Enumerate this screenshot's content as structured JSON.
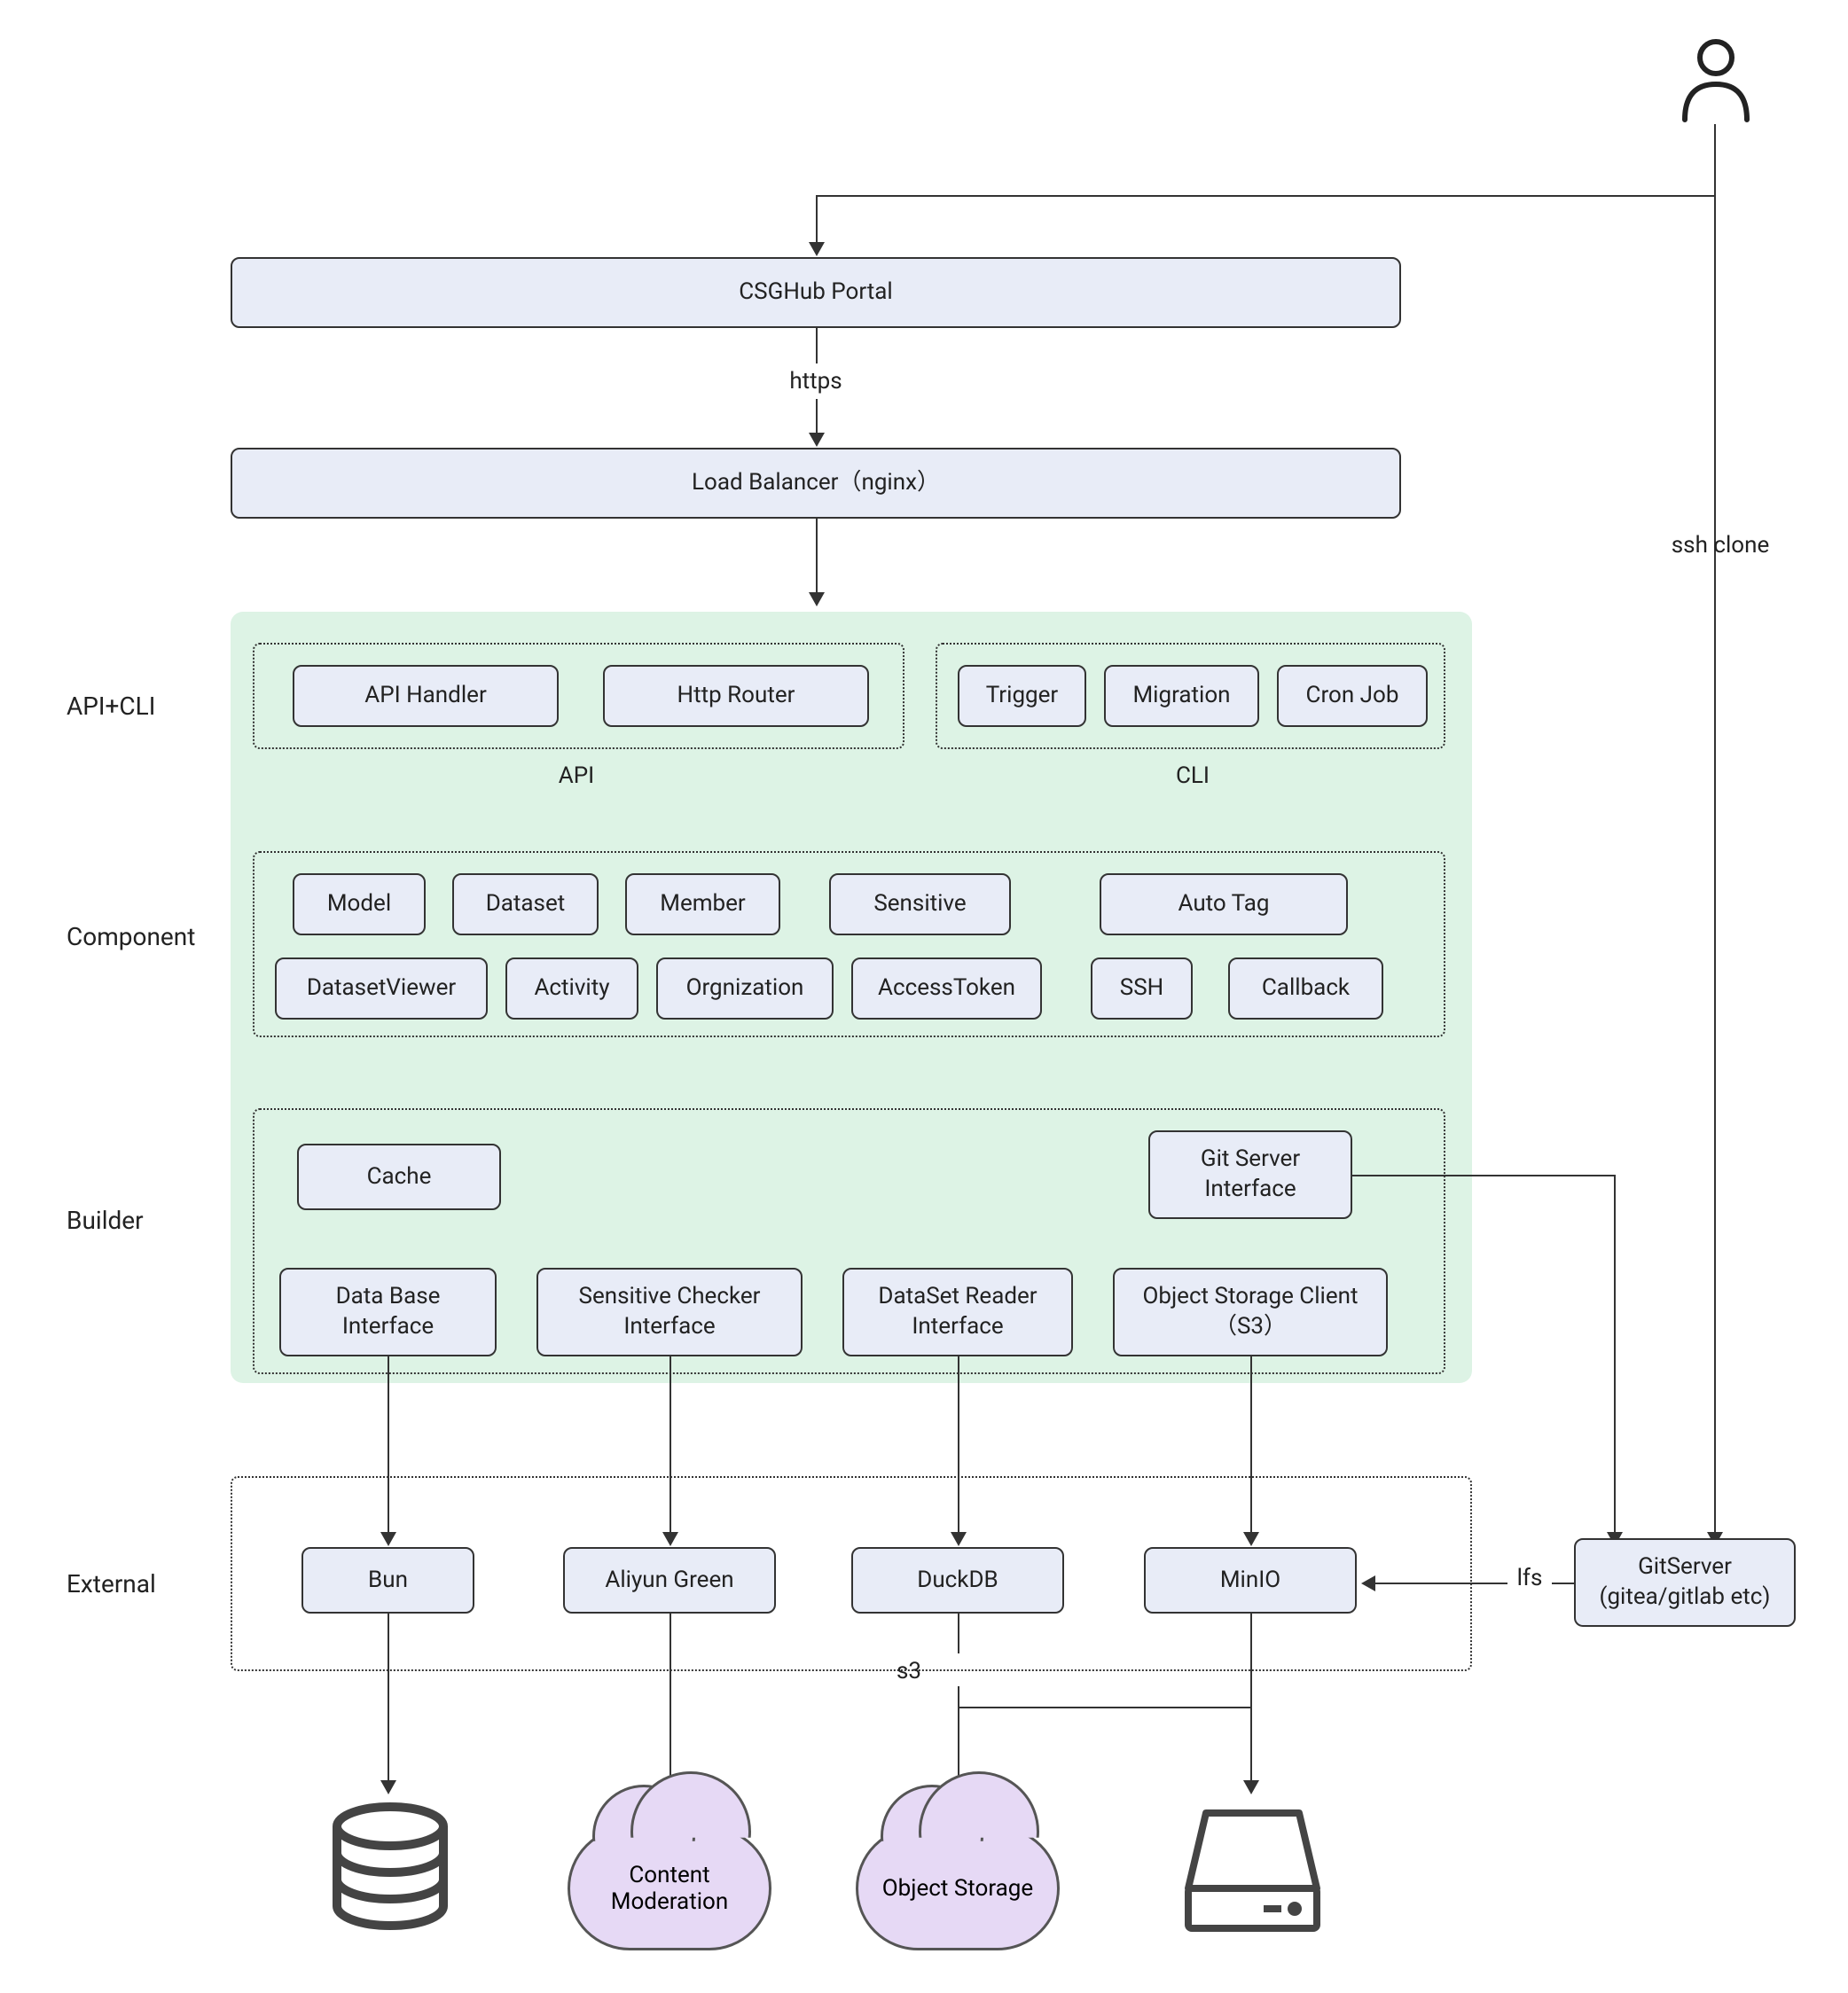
{
  "top": {
    "portal": "CSGHub Portal",
    "load_balancer": "Load Balancer（nginx）",
    "https_label": "https",
    "ssh_label": "ssh clone"
  },
  "row_labels": {
    "api_cli": "API+CLI",
    "component": "Component",
    "builder": "Builder",
    "external": "External"
  },
  "api_cli": {
    "api_handler": "API Handler",
    "http_router": "Http Router",
    "api_label": "API",
    "trigger": "Trigger",
    "migration": "Migration",
    "cron_job": "Cron Job",
    "cli_label": "CLI"
  },
  "component": {
    "model": "Model",
    "dataset": "Dataset",
    "member": "Member",
    "sensitive": "Sensitive",
    "auto_tag": "Auto Tag",
    "dataset_viewer": "DatasetViewer",
    "activity": "Activity",
    "organization": "Orgnization",
    "access_token": "AccessToken",
    "ssh": "SSH",
    "callback": "Callback"
  },
  "builder": {
    "cache": "Cache",
    "git_server_interface": "Git Server Interface",
    "database_interface": "Data Base Interface",
    "sensitive_checker_interface": "Sensitive Checker Interface",
    "dataset_reader_interface": "DataSet Reader Interface",
    "object_storage_client": "Object Storage Client（S3）"
  },
  "external": {
    "bun": "Bun",
    "aliyun_green": "Aliyun Green",
    "duckdb": "DuckDB",
    "minio": "MinIO",
    "gitserver": "GitServer (gitea/gitlab etc)",
    "lfs_label": "lfs",
    "s3_label": "s3"
  },
  "clouds": {
    "content_moderation": "Content Moderation",
    "object_storage": "Object Storage"
  }
}
